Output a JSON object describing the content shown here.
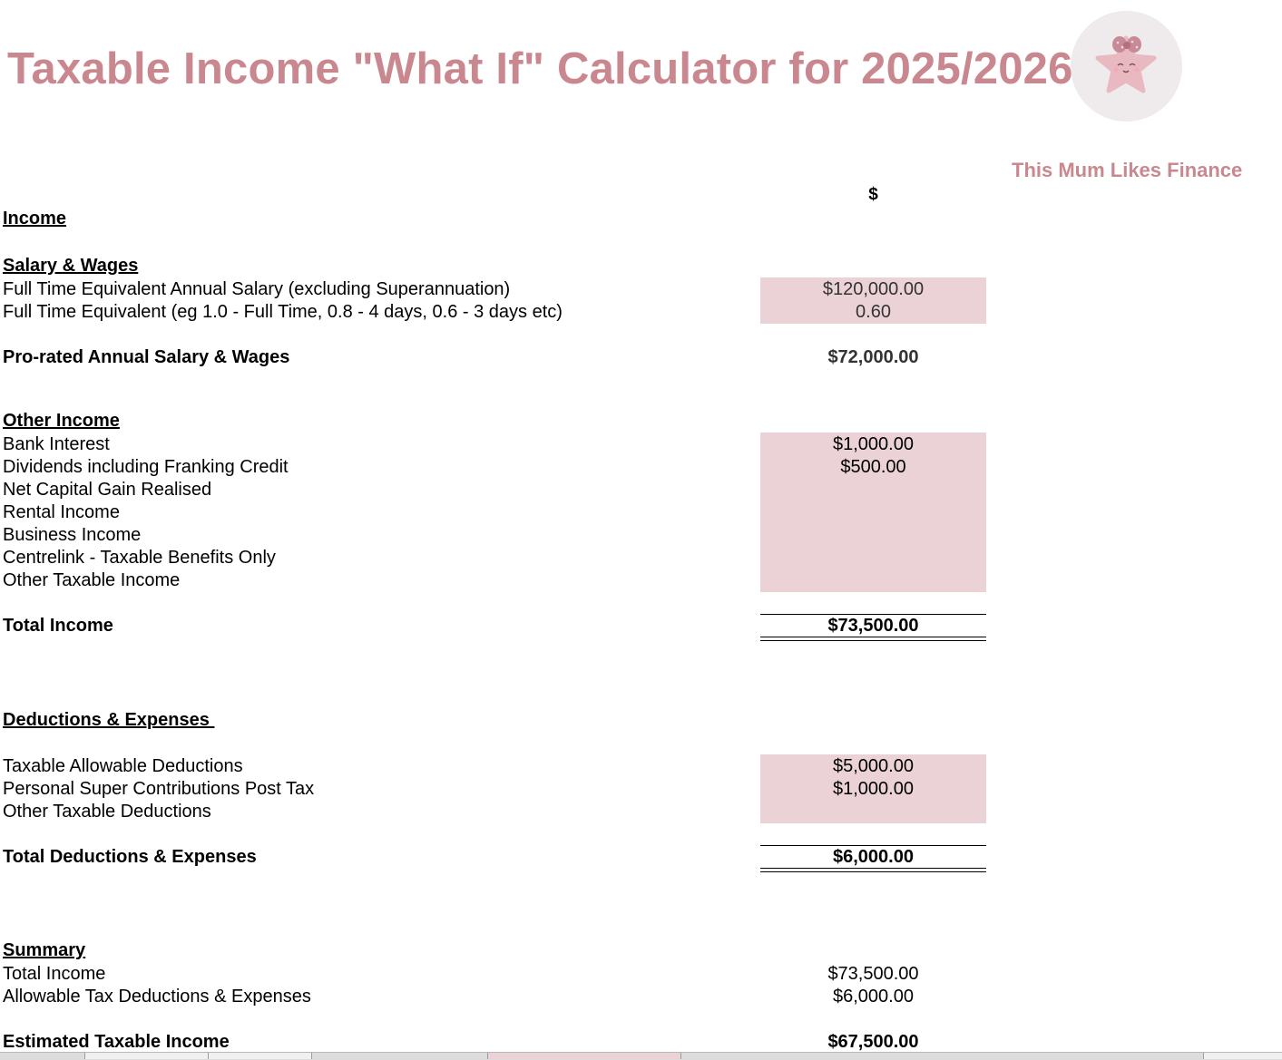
{
  "title": "Taxable Income \"What If\" Calculator for 2025/2026",
  "brand": "This Mum Likes Finance",
  "logo": {
    "icon": "star-with-bow-icon",
    "color": "#e9b9c2"
  },
  "colors": {
    "accent": "#c9888f",
    "input_fill": "#ebd2d6"
  },
  "currency_header": "$",
  "income": {
    "heading": "Income",
    "salary_wages": {
      "heading": "Salary & Wages",
      "fte_salary_label": "Full Time Equivalent Annual Salary (excluding Superannuation)",
      "fte_salary_value": "$120,000.00",
      "fte_label": "Full Time Equivalent (eg 1.0 - Full Time, 0.8 - 4 days, 0.6 - 3 days etc)",
      "fte_value": "0.60",
      "prorated_label": "Pro-rated Annual Salary & Wages",
      "prorated_value": "$72,000.00"
    },
    "other_income": {
      "heading": "Other Income",
      "items": [
        {
          "label": "Bank Interest",
          "value": "$1,000.00"
        },
        {
          "label": "Dividends including Franking Credit",
          "value": "$500.00"
        },
        {
          "label": "Net Capital Gain Realised",
          "value": ""
        },
        {
          "label": "Rental Income",
          "value": ""
        },
        {
          "label": "Business Income",
          "value": ""
        },
        {
          "label": "Centrelink - Taxable Benefits Only",
          "value": ""
        },
        {
          "label": "Other Taxable Income",
          "value": ""
        }
      ]
    },
    "total_label": "Total Income",
    "total_value": "$73,500.00"
  },
  "deductions": {
    "heading": "Deductions & Expenses ",
    "items": [
      {
        "label": "Taxable Allowable Deductions",
        "value": "$5,000.00"
      },
      {
        "label": "Personal Super Contributions Post Tax",
        "value": "$1,000.00"
      },
      {
        "label": "Other Taxable Deductions",
        "value": ""
      }
    ],
    "total_label": "Total Deductions & Expenses",
    "total_value": "$6,000.00"
  },
  "summary": {
    "heading": "Summary",
    "total_income_label": "Total Income",
    "total_income_value": "$73,500.00",
    "deductions_label": "Allowable Tax Deductions & Expenses",
    "deductions_value": "$6,000.00",
    "taxable_label": "Estimated Taxable Income",
    "taxable_value": "$67,500.00"
  }
}
